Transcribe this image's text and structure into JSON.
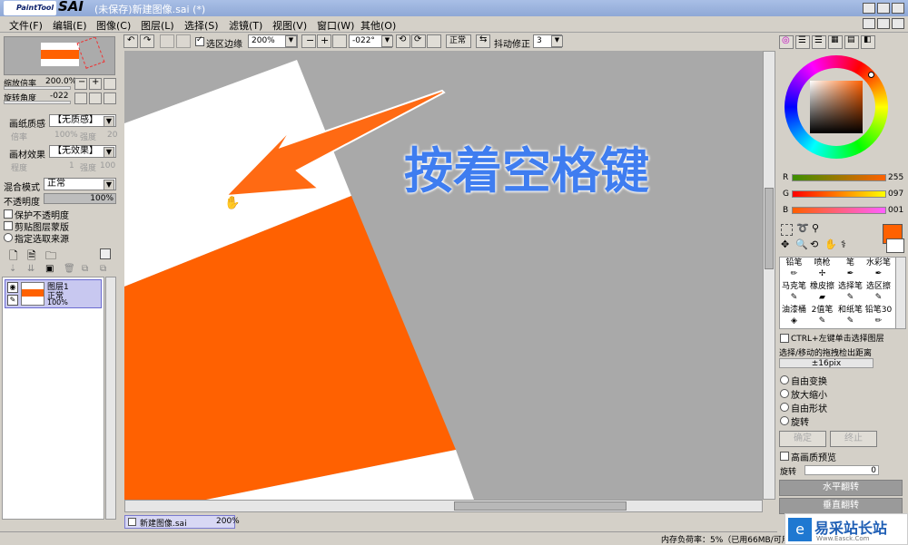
{
  "app": {
    "logo": "PaintTool",
    "logo_big": "SAI",
    "title": "(未保存)新建图像.sai (*)"
  },
  "menu": [
    "文件(F)",
    "编辑(E)",
    "图像(C)",
    "图层(L)",
    "选择(S)",
    "滤镜(T)",
    "视图(V)",
    "窗口(W)",
    "其他(O)"
  ],
  "toolbar": {
    "select_edge_label": "选区边缘",
    "zoom": "200%",
    "angle": "-022°",
    "mode": "正常",
    "stabilizer_label": "抖动修正",
    "stabilizer": "3"
  },
  "navigator": {
    "zoom_label": "缩放倍率",
    "zoom": "200.0%",
    "angle_label": "旋转角度",
    "angle": "-022"
  },
  "paper": {
    "texture_label": "画纸质感",
    "texture": "【无质感】",
    "scale_label": "倍率",
    "scale": "100%",
    "strength_label": "强度",
    "strength": "20",
    "effect_label": "画材效果",
    "effect": "【无效果】",
    "degree_label": "程度",
    "degree": "1",
    "effect_strength": "100"
  },
  "layer_props": {
    "blend_label": "混合模式",
    "blend": "正常",
    "opacity_label": "不透明度",
    "opacity": "100%",
    "preserve_opacity": "保护不透明度",
    "clip_group": "剪贴图层蒙版",
    "select_source": "指定选取来源"
  },
  "layers": [
    {
      "name": "图层1",
      "mode": "正常",
      "opacity": "100%"
    }
  ],
  "canvas": {
    "overlay_text": "按着空格键"
  },
  "doc_tab": {
    "name": "新建图像.sai",
    "zoom": "200%"
  },
  "status": {
    "memory": "内存负荷率：5%（已用66MB/可用"
  },
  "color": {
    "r_label": "R",
    "r": "255",
    "g_label": "G",
    "g": "097",
    "b_label": "B",
    "b": "001",
    "primary": "#ff6101"
  },
  "tools": [
    [
      "铅笔",
      "喷枪",
      "笔",
      "水彩笔"
    ],
    [
      "马克笔",
      "橡皮擦",
      "选择笔",
      "选区擦"
    ],
    [
      "油漆桶",
      "2值笔",
      "和纸笔",
      "铅笔30"
    ]
  ],
  "options": {
    "ctrl_select": "CTRL+左键单击选择图层",
    "drag_distance_label": "选择/移动的拖拽检出距离",
    "drag_distance": "±16pix",
    "free_transform": "自由变换",
    "scale": "放大缩小",
    "free_shape": "自由形状",
    "rotate": "旋转",
    "confirm": "确定",
    "cancel": "终止",
    "hq_preview": "高画质预览",
    "rotation_label": "旋转",
    "rotation": "0",
    "flip_h": "水平翻转",
    "flip_v": "垂直翻转"
  },
  "watermark": {
    "main": "易采站长站",
    "sub": "Www.Easck.Com"
  }
}
